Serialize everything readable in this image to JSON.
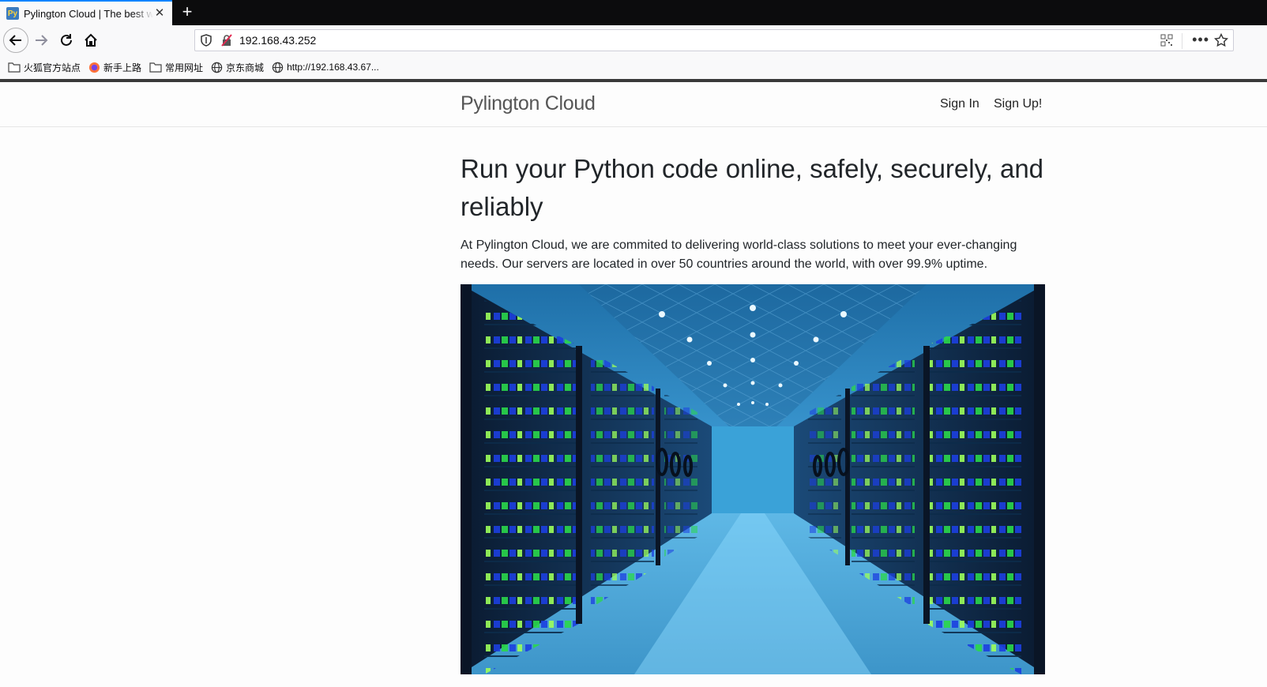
{
  "browser": {
    "tab": {
      "favicon_text": "Py",
      "title": "Pylington Cloud | The best way to run Python"
    },
    "url": "192.168.43.252",
    "bookmarks": [
      {
        "label": "火狐官方站点",
        "icon": "folder-icon"
      },
      {
        "label": "新手上路",
        "icon": "firefox-icon"
      },
      {
        "label": "常用网址",
        "icon": "folder-icon"
      },
      {
        "label": "京东商城",
        "icon": "globe-icon"
      },
      {
        "label": "http://192.168.43.67...",
        "icon": "globe-icon"
      }
    ]
  },
  "site": {
    "brand": "Pylington Cloud",
    "nav": {
      "signin": "Sign In",
      "signup": "Sign Up!"
    },
    "headline": "Run your Python code online, safely, securely, and reliably",
    "lead": "At Pylington Cloud, we are commited to delivering world-class solutions to meet your ever-changing needs. Our servers are located in over 50 countries around the world, with over 99.9% uptime."
  },
  "colors": {
    "tabstrip": "#0c0c0d",
    "accent": "#0a84ff",
    "hero_sky": "#1e6fa8"
  }
}
